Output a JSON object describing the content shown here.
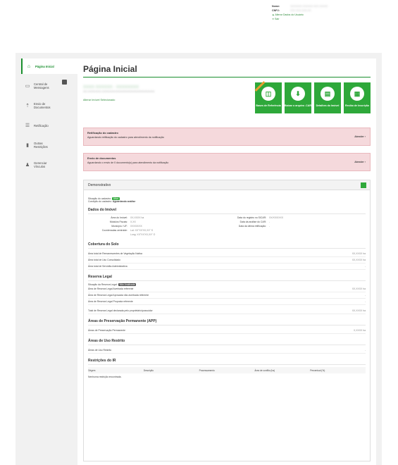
{
  "user": {
    "nome_label": "Nome:",
    "cnpj_label": "CNPJ:",
    "nome_value": "XXXXXXX XXXXXX XXX XXXXX",
    "cnpj_value": "XXX.XXX.XXX-XX",
    "alterar": "Alterar Dados do Usuário",
    "sair": "Sair"
  },
  "sidebar": {
    "items": [
      {
        "label": "Página Inicial",
        "icon": "home-icon"
      },
      {
        "label": "Central de Mensagens",
        "icon": "inbox-icon"
      },
      {
        "label": "Envio de Documentos",
        "icon": "upload-icon"
      },
      {
        "label": "Retificação",
        "icon": "list-icon"
      },
      {
        "label": "Outras Restrições",
        "icon": "file-icon"
      },
      {
        "label": "Gerenciar Vínculos",
        "icon": "user-icon"
      }
    ]
  },
  "page": {
    "title": "Página Inicial",
    "property_name": "XXXX XXXXXX - XXXXXXXX",
    "property_sub": "XX-XXXXXXX-XXXXXXXXXXXXXXXXXXXXXXXXXXXX",
    "property_link": "Alterar Imóvel Selecionado"
  },
  "tiles": [
    {
      "label": "Bases de Referência",
      "icon": "map-icon"
    },
    {
      "label": "Baixar o arquivo .CAR",
      "icon": "download-icon"
    },
    {
      "label": "Detalhes do Imóvel",
      "icon": "document-icon"
    },
    {
      "label": "Recibo de Inscrição",
      "icon": "receipt-icon"
    }
  ],
  "alerts": [
    {
      "title": "Retificação do cadastro",
      "text": "Aguardando retificação do cadastro para atendimento da notificação",
      "action": "Atender"
    },
    {
      "title": "Envio de documentos",
      "text": "Aguardando o envio de 0 documento(s) para atendimento da notificação",
      "action": "Atender"
    }
  ],
  "demo": {
    "title": "Demonstrativo",
    "situacao_label": "Situação do cadastro:",
    "situacao_value": "Ativo",
    "condicao_label": "Condição do cadastro:",
    "condicao_value": "Aguardando análise",
    "dados_title": "Dados do Imóvel",
    "dados_left": [
      {
        "k": "Área do Imóvel:",
        "v": "XX,XXXX ha"
      },
      {
        "k": "Módulos Fiscais:",
        "v": "X,XX"
      },
      {
        "k": "Município / UF:",
        "v": "XXXXX/XX"
      },
      {
        "k": "Coordenadas centroide:",
        "v": "Lat: XX°XX'XX,XX\" S"
      },
      {
        "k": "",
        "v": "Long: XX°XX'XX,XX\" O"
      }
    ],
    "dados_right": [
      {
        "k": "Data do registro no SICAR:",
        "v": "XX/XX/XXXX"
      },
      {
        "k": "Data da análise do CAR:",
        "v": "-"
      },
      {
        "k": "Data da última retificação:",
        "v": "-"
      }
    ],
    "cobertura_title": "Cobertura do Solo",
    "cobertura": [
      {
        "k": "Área total de Remanescentes de Vegetação Nativa",
        "v": "XX,XXXX ha"
      },
      {
        "k": "Área total de Uso Consolidado",
        "v": "XX,XXXX ha"
      },
      {
        "k": "Área total de Servidão Administrativa",
        "v": "-"
      }
    ],
    "reserva_title": "Reserva Legal",
    "reserva_sit_label": "Situação da Reserva Legal:",
    "reserva_sit_value": "Não Analisada",
    "reserva": [
      {
        "k": "Área de Reserva Legal Averbada referente",
        "v": "XX,XXXX ha"
      },
      {
        "k": "Área de Reserva Legal Aprovada não averbada referente",
        "v": "-"
      },
      {
        "k": "Área de Reserva Legal Proposta referente",
        "v": "-"
      }
    ],
    "reserva_total": {
      "k": "Total de Reserva Legal declarada pelo proprietário/possuidor",
      "v": "XX,XXXX ha"
    },
    "app_title": "Áreas de Preservação Permanente (APP)",
    "app": {
      "k": "Áreas de Preservação Permanente",
      "v": "X,XXXX ha"
    },
    "uso_title": "Áreas de Uso Restrito",
    "uso": {
      "k": "Áreas de Uso Restrito",
      "v": "-"
    },
    "restr_title": "Restrições do IR",
    "restr_cols": [
      "Origem",
      "Descrição",
      "Processamento",
      "Área de conflito (ha)",
      "Percentual (%)"
    ],
    "restr_note": "Nenhuma restrição encontrada."
  }
}
